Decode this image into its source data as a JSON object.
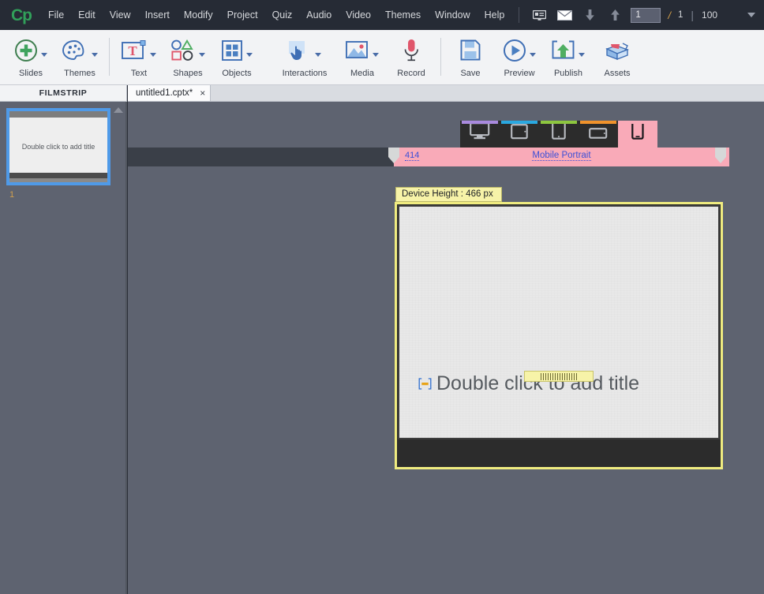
{
  "app": {
    "logo": "Cp",
    "menus": [
      "File",
      "Edit",
      "View",
      "Insert",
      "Modify",
      "Project",
      "Quiz",
      "Audio",
      "Video",
      "Themes",
      "Window",
      "Help"
    ],
    "quick_icons": [
      {
        "name": "slide-notes-icon",
        "glyph": "card"
      },
      {
        "name": "email-icon",
        "glyph": "envelope"
      },
      {
        "name": "move-down-icon",
        "glyph": "arrow-down"
      },
      {
        "name": "move-up-icon",
        "glyph": "arrow-up"
      }
    ],
    "page_current": "1",
    "page_separator": "/",
    "page_total": "1",
    "divider": "|",
    "zoom_value": "100"
  },
  "toolbar": {
    "groups": [
      {
        "items": [
          {
            "label": "Slides",
            "icon": "plus-circle-icon",
            "has_caret": true
          },
          {
            "label": "Themes",
            "icon": "palette-icon",
            "has_caret": true
          }
        ]
      },
      {
        "items": [
          {
            "label": "Text",
            "icon": "text-box-icon",
            "has_caret": true
          },
          {
            "label": "Shapes",
            "icon": "shapes-icon",
            "has_caret": true
          },
          {
            "label": "Objects",
            "icon": "objects-grid-icon",
            "has_caret": true
          }
        ]
      },
      {
        "items": [
          {
            "label": "Interactions",
            "icon": "hand-pointer-icon",
            "has_caret": true
          },
          {
            "label": "Media",
            "icon": "image-icon",
            "has_caret": true
          },
          {
            "label": "Record",
            "icon": "microphone-icon",
            "has_caret": false
          }
        ]
      },
      {
        "items": [
          {
            "label": "Save",
            "icon": "floppy-disk-icon",
            "has_caret": false
          },
          {
            "label": "Preview",
            "icon": "play-circle-icon",
            "has_caret": true
          },
          {
            "label": "Publish",
            "icon": "publish-upload-icon",
            "has_caret": true
          },
          {
            "label": "Assets",
            "icon": "assets-box-icon",
            "has_caret": false
          }
        ]
      }
    ]
  },
  "filmstrip": {
    "title": "FILMSTRIP",
    "slides": [
      {
        "number": "1",
        "placeholder": "Double click to add title"
      }
    ]
  },
  "document_tab": {
    "title": "untitled1.cptx*",
    "close_glyph": "×"
  },
  "breakpoints": {
    "devices": [
      {
        "name": "desktop",
        "icon": "monitor-icon",
        "accent": "#a98ade",
        "selected": false
      },
      {
        "name": "tablet-portrait",
        "icon": "tablet-landscape-icon",
        "accent": "#2aa8e0",
        "selected": false
      },
      {
        "name": "tablet",
        "icon": "tablet-portrait-icon",
        "accent": "#8dc63f",
        "selected": false
      },
      {
        "name": "mobile-landscape",
        "icon": "phone-landscape-icon",
        "accent": "#f0922b",
        "selected": false
      },
      {
        "name": "mobile-portrait",
        "icon": "phone-portrait-icon",
        "accent": "#f9aab8",
        "selected": true
      }
    ]
  },
  "ruler": {
    "width_value": "414",
    "breakpoint_name": "Mobile Portrait",
    "accent": "#f9aab8",
    "link_color": "#3c4fd6"
  },
  "stage": {
    "device_height_label": "Device Height : 466 px",
    "title_placeholder": "Double click to add title",
    "marker_icon": "responsive-position-marker-icon",
    "drag_handle_icon": "resize-grip-icon"
  }
}
